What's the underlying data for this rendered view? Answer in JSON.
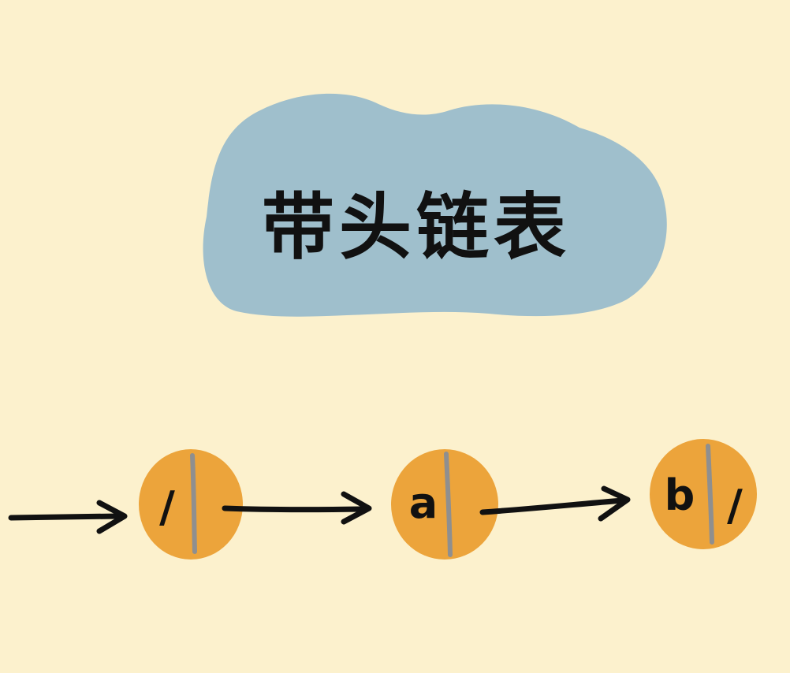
{
  "diagram": {
    "title": "带头链表",
    "nodes": [
      {
        "id": "head",
        "data": "/",
        "next": ""
      },
      {
        "id": "node-a",
        "data": "a",
        "next": ""
      },
      {
        "id": "node-b",
        "data": "b",
        "next": "/"
      }
    ],
    "edges": [
      {
        "from": "entry",
        "to": "head"
      },
      {
        "from": "head",
        "to": "node-a"
      },
      {
        "from": "node-a",
        "to": "node-b"
      }
    ]
  },
  "colors": {
    "background": "#fcf1cd",
    "cloud": "#9fbfcc",
    "node_fill": "#eca43b",
    "divider": "#8f8f8f",
    "ink": "#111111"
  }
}
